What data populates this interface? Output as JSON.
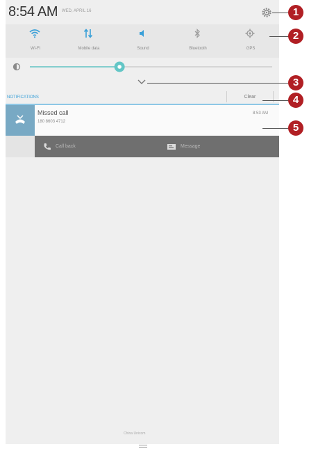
{
  "status": {
    "time": "8:54 AM",
    "date": "WED, APRIL 16",
    "settings_icon": "gear-icon"
  },
  "quick_settings": [
    {
      "label": "Wi-Fi",
      "icon": "wifi-icon",
      "active": true
    },
    {
      "label": "Mobile data",
      "icon": "mobile-data-icon",
      "active": true
    },
    {
      "label": "Sound",
      "icon": "sound-icon",
      "active": true
    },
    {
      "label": "Bluetooth",
      "icon": "bluetooth-icon",
      "active": false
    },
    {
      "label": "GPS",
      "icon": "gps-icon",
      "active": false
    }
  ],
  "brightness": {
    "level": 0.37,
    "icon": "brightness-icon"
  },
  "notifications": {
    "header": "NOTIFICATIONS",
    "clear_label": "Clear",
    "items": [
      {
        "title": "Missed call",
        "number": "180 8603 4712",
        "time": "8:53 AM",
        "icon": "missed-call-icon",
        "actions": [
          {
            "label": "Call back",
            "icon": "phone-icon"
          },
          {
            "label": "Message",
            "icon": "message-icon"
          }
        ]
      }
    ]
  },
  "footer": {
    "label": "China Unicom"
  },
  "callouts": [
    "1",
    "2",
    "3",
    "4",
    "5"
  ],
  "colors": {
    "accent": "#3aa0d8",
    "callout": "#b11f24",
    "slider": "#63c6c6"
  }
}
